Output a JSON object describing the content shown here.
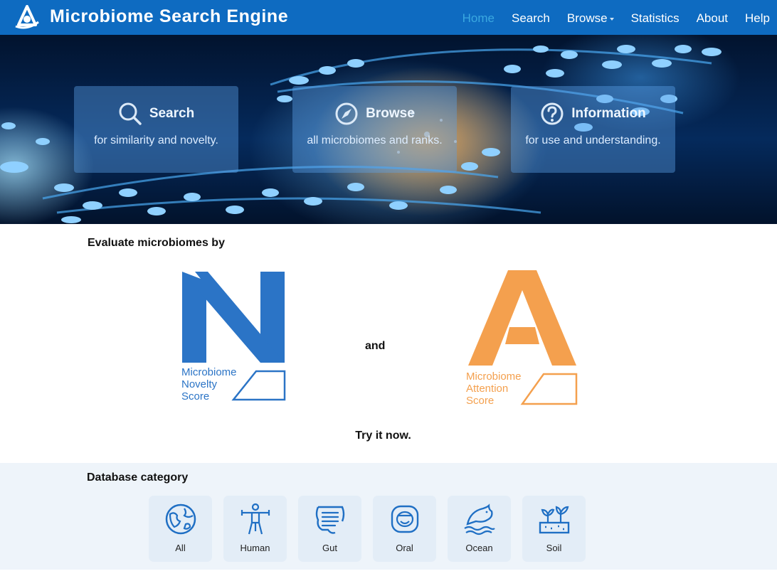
{
  "brand": {
    "title": "Microbiome Search Engine"
  },
  "nav": {
    "items": [
      {
        "label": "Home",
        "active": true
      },
      {
        "label": "Search"
      },
      {
        "label": "Browse",
        "dropdown": true
      },
      {
        "label": "Statistics"
      },
      {
        "label": "About"
      },
      {
        "label": "Help"
      }
    ]
  },
  "hero": {
    "cards": [
      {
        "title": "Search",
        "subtitle": "for similarity and novelty.",
        "icon": "search-icon"
      },
      {
        "title": "Browse",
        "subtitle": "all microbiomes and ranks.",
        "icon": "compass-icon"
      },
      {
        "title": "Information",
        "subtitle": "for use and understanding.",
        "icon": "question-icon"
      }
    ]
  },
  "evaluate": {
    "title": "Evaluate microbiomes by",
    "novelty_logo": {
      "lines": [
        "Microbiome",
        "Novelty",
        "Score"
      ],
      "color": "#2b74c6"
    },
    "and": "and",
    "attention_logo": {
      "lines": [
        "Microbiome",
        "Attention",
        "Score"
      ],
      "color": "#f4a04e"
    },
    "cta": "Try it now."
  },
  "database": {
    "title": "Database category",
    "categories": [
      {
        "label": "All",
        "icon": "globe-icon"
      },
      {
        "label": "Human",
        "icon": "human-icon"
      },
      {
        "label": "Gut",
        "icon": "gut-icon"
      },
      {
        "label": "Oral",
        "icon": "mouth-icon"
      },
      {
        "label": "Ocean",
        "icon": "dolphin-icon"
      },
      {
        "label": "Soil",
        "icon": "sprout-icon"
      }
    ],
    "icon_color": "#1f6fc4"
  },
  "colors": {
    "navbar": "#0e6bc1",
    "nav_active": "#3aa8e0",
    "section_bg": "#eef4fa"
  }
}
